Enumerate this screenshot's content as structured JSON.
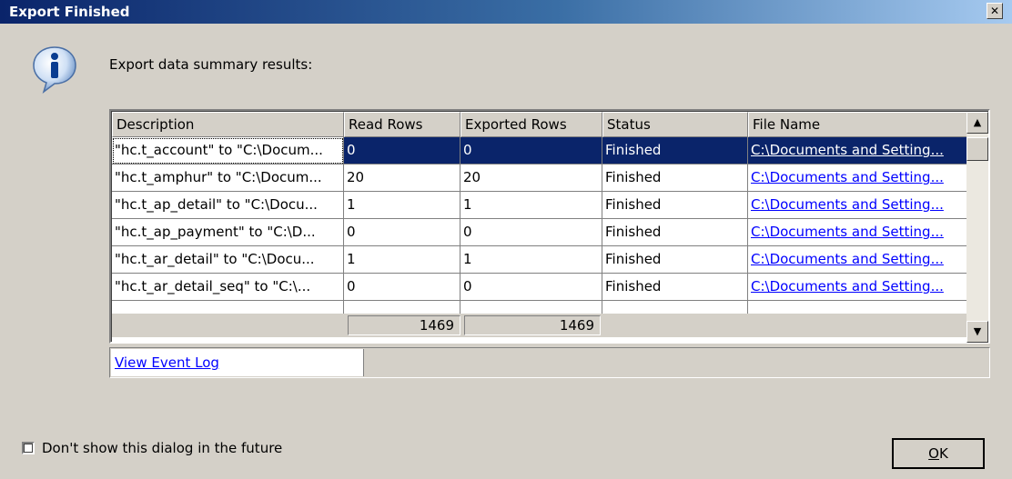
{
  "window": {
    "title": "Export Finished"
  },
  "dialog": {
    "summary_label": "Export data summary results:"
  },
  "grid": {
    "columns": [
      "Description",
      "Read Rows",
      "Exported Rows",
      "Status",
      "File Name"
    ],
    "rows": [
      {
        "description": "\"hc.t_account\" to \"C:\\Docum...",
        "read_rows": "0",
        "exported_rows": "0",
        "status": "Finished",
        "file_name": "C:\\Documents and Setting...",
        "selected": true
      },
      {
        "description": "\"hc.t_amphur\" to \"C:\\Docum...",
        "read_rows": "20",
        "exported_rows": "20",
        "status": "Finished",
        "file_name": "C:\\Documents and Setting..."
      },
      {
        "description": "\"hc.t_ap_detail\" to \"C:\\Docu...",
        "read_rows": "1",
        "exported_rows": "1",
        "status": "Finished",
        "file_name": "C:\\Documents and Setting..."
      },
      {
        "description": "\"hc.t_ap_payment\" to \"C:\\D...",
        "read_rows": "0",
        "exported_rows": "0",
        "status": "Finished",
        "file_name": "C:\\Documents and Setting..."
      },
      {
        "description": "\"hc.t_ar_detail\" to \"C:\\Docu...",
        "read_rows": "1",
        "exported_rows": "1",
        "status": "Finished",
        "file_name": "C:\\Documents and Setting..."
      },
      {
        "description": "\"hc.t_ar_detail_seq\" to \"C:\\...",
        "read_rows": "0",
        "exported_rows": "0",
        "status": "Finished",
        "file_name": "C:\\Documents and Setting..."
      }
    ],
    "totals": {
      "read_rows": "1469",
      "exported_rows": "1469"
    }
  },
  "event_log_link": "View Event Log",
  "checkbox": {
    "label": "Don't show this dialog in the future",
    "checked": false
  },
  "ok_button": {
    "label": "OK",
    "accelerator": "O",
    "rest": "K"
  },
  "icons": {
    "info": "info-icon",
    "close": "close-icon",
    "scroll_up": "arrow-up-icon",
    "scroll_down": "arrow-down-icon"
  },
  "colors": {
    "title_start": "#0a246a",
    "title_end": "#a6caf0",
    "selection": "#0a246a",
    "link": "#0000ff",
    "face": "#d4d0c8"
  }
}
